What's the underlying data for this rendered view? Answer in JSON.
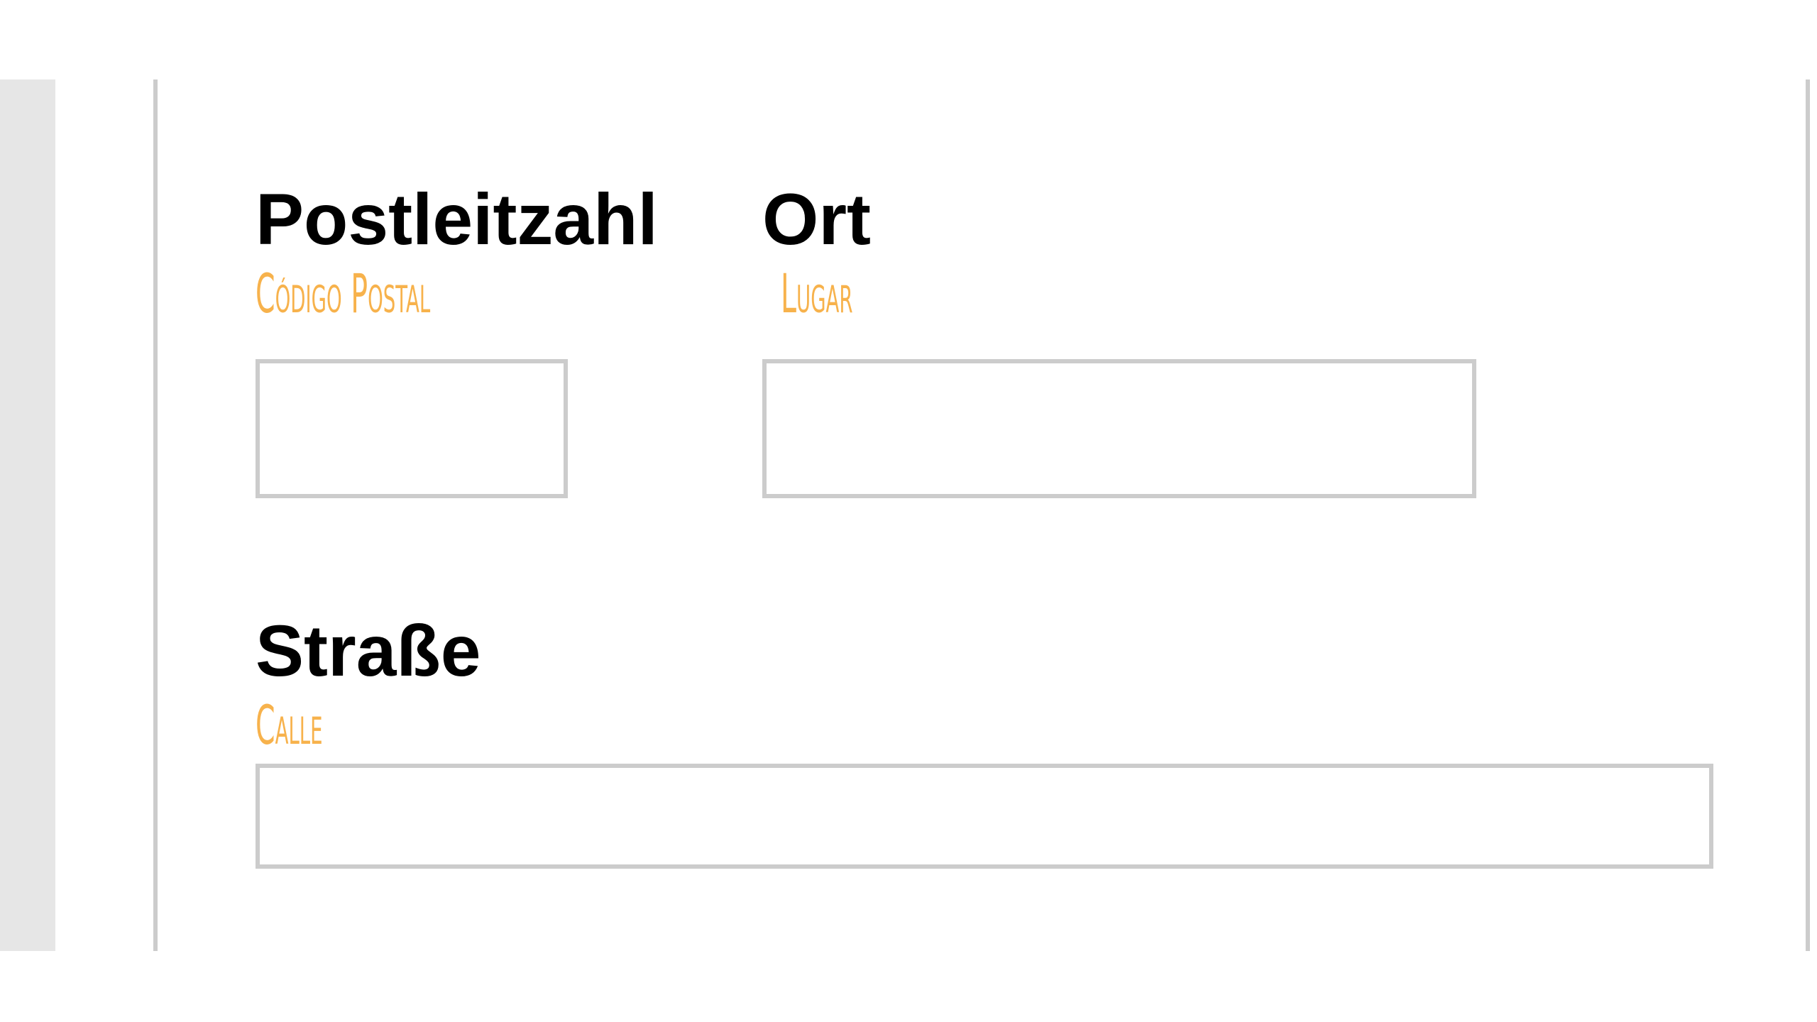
{
  "form": {
    "postal_code": {
      "label_de": "Postleitzahl",
      "label_es": "Código Postal",
      "value": ""
    },
    "city": {
      "label_de": "Ort",
      "label_es": "Lugar",
      "value": ""
    },
    "street": {
      "label_de": "Straße",
      "label_es": "Calle",
      "value": ""
    }
  },
  "colors": {
    "label_primary": "#000000",
    "label_translation": "#f7b24c",
    "field_border": "#cccccc",
    "side_panel": "#e6e6e6"
  }
}
